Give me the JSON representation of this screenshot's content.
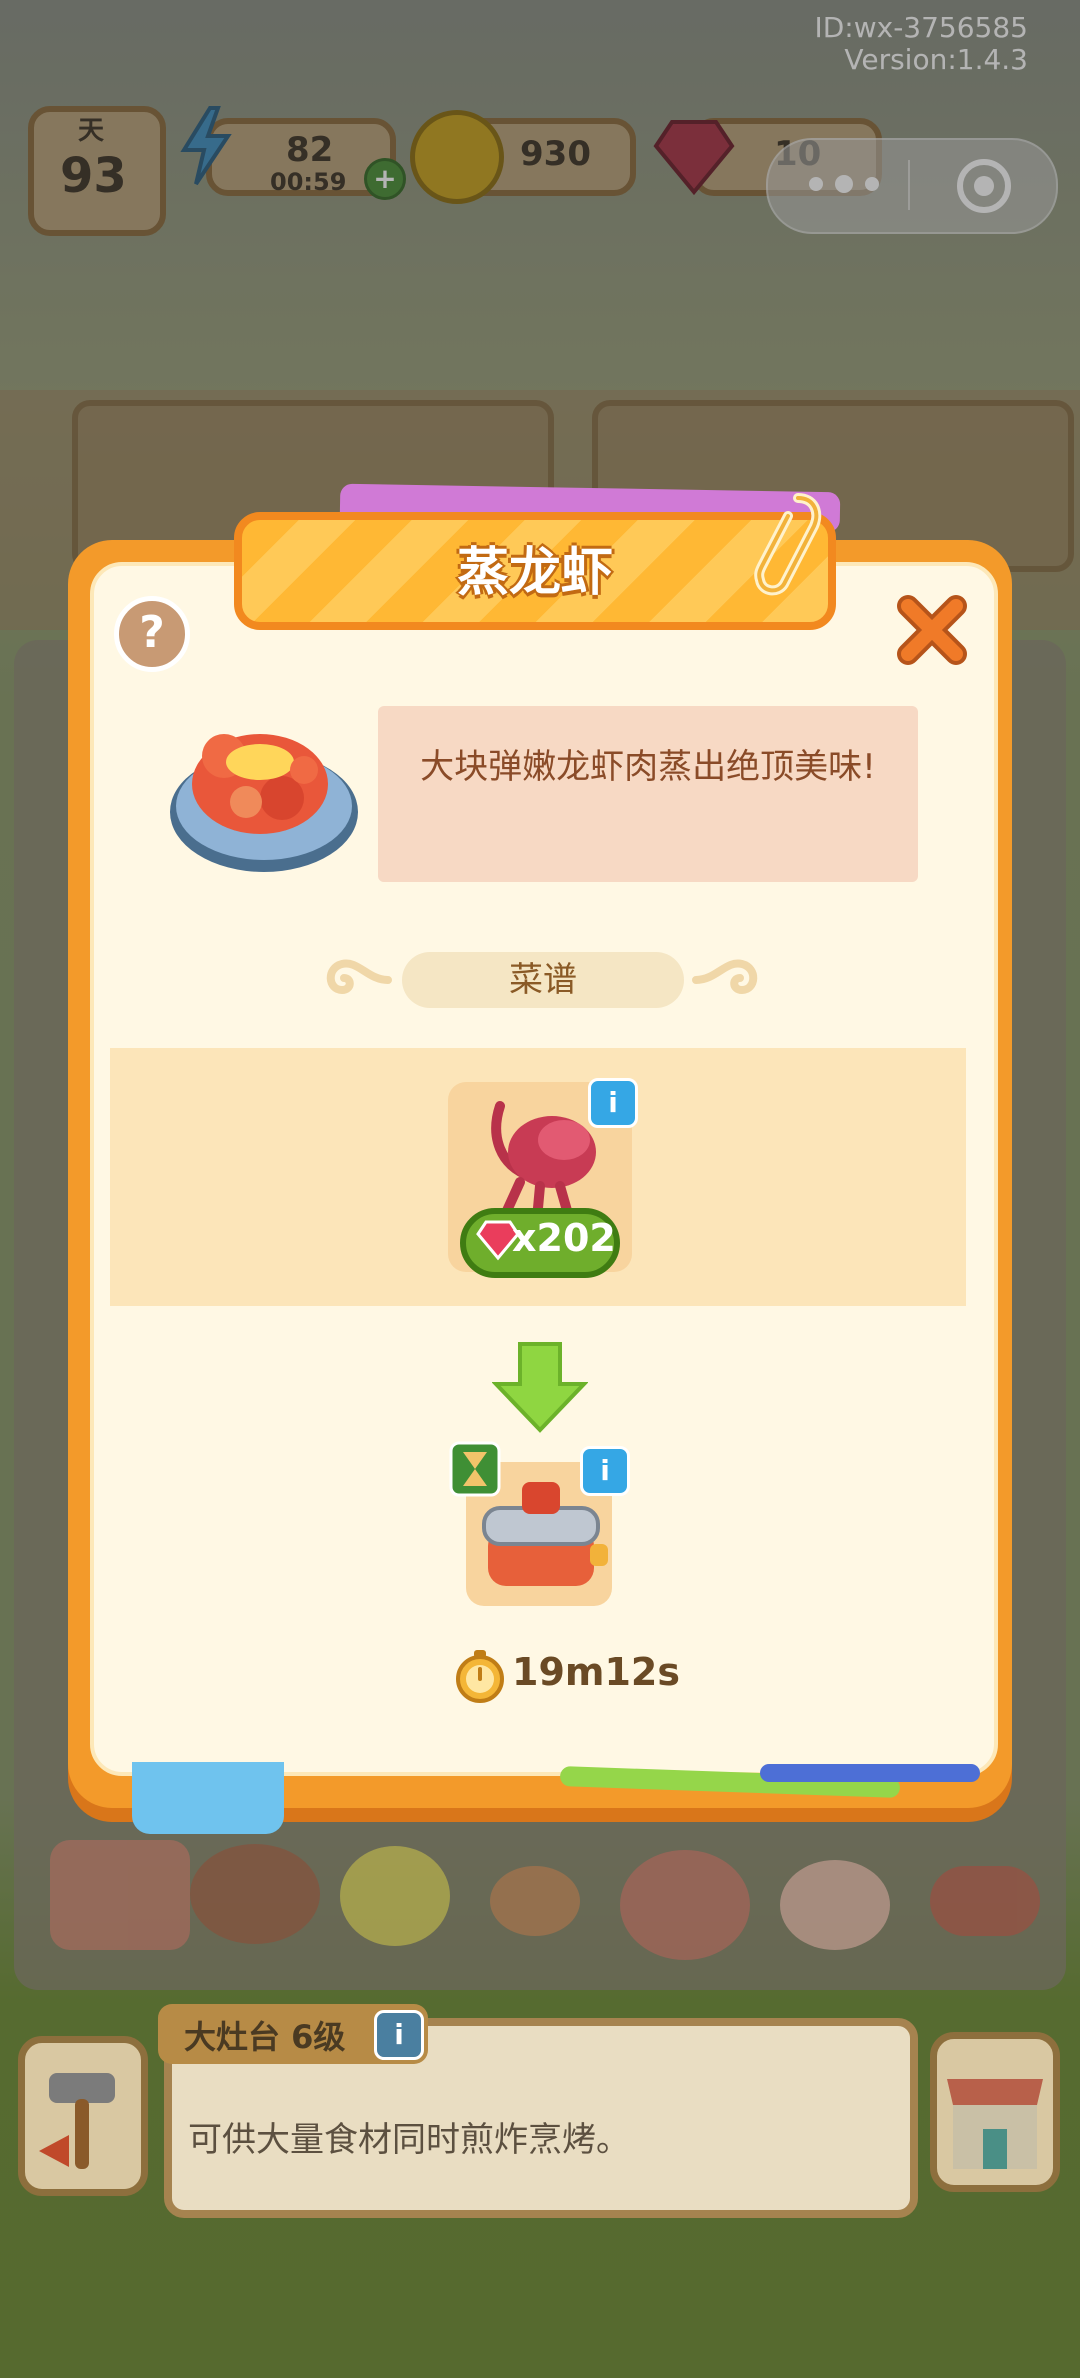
{
  "header": {
    "user_id": "ID:wx-3756585",
    "version": "Version:1.4.3"
  },
  "hud": {
    "day_label": "天",
    "day_value": "93",
    "energy_value": "82",
    "energy_timer": "00:59",
    "coins_value": "930",
    "gems_value": "10"
  },
  "dialog": {
    "title": "蒸龙虾",
    "description": "大块弹嫩龙虾肉蒸出绝顶美味!",
    "recipe_label": "菜谱",
    "ingredient_quantity": "x202",
    "cook_time": "19m12s"
  },
  "bottom": {
    "station_name": "大灶台 6级",
    "station_description": "可供大量食材同时煎炸烹烤。"
  },
  "colors": {
    "modal_orange": "#f39a2a",
    "panel_cream": "#fff8e4",
    "info_blue": "#35a7e5",
    "quantity_green": "#6fae2c",
    "arrow_green": "#8fd641"
  }
}
